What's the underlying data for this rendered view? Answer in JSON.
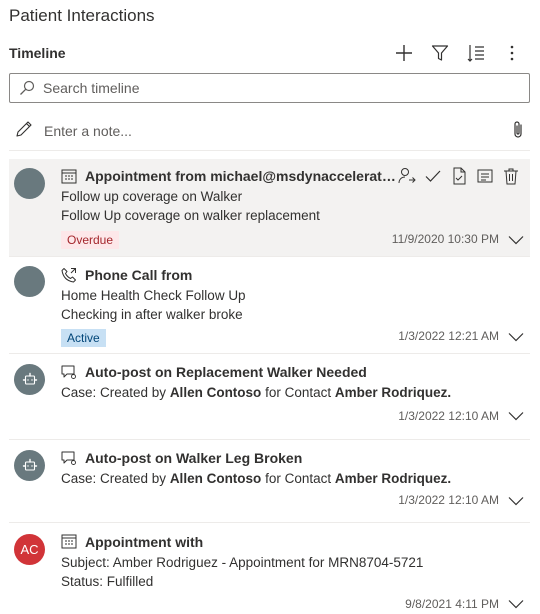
{
  "page": {
    "title": "Patient Interactions"
  },
  "timeline": {
    "label": "Timeline",
    "tools": [
      "add-icon",
      "filter-icon",
      "sort-icon",
      "more-options-icon"
    ],
    "search_placeholder": "Search timeline",
    "note_placeholder": "Enter a note..."
  },
  "items": [
    {
      "type_icon": "calendar-icon",
      "avatar": "",
      "title": "Appointment from michael@msdynaccelerators.com",
      "line1": "Follow up coverage on Walker",
      "line2": "Follow Up coverage on walker replacement",
      "badge": "Overdue",
      "date": "11/9/2020 10:30 PM"
    },
    {
      "type_icon": "phone-icon",
      "avatar": "",
      "title": "Phone Call from",
      "line1": "Home Health Check Follow Up",
      "line2": "Checking in after walker broke",
      "badge": "Active",
      "date": "1/3/2022 12:21 AM"
    },
    {
      "type_icon": "post-icon",
      "title": "Auto-post on Replacement Walker Needed",
      "line_prefix": "Case: Created by ",
      "line_person": "Allen Contoso",
      "line_mid": " for Contact ",
      "line_contact": "Amber Rodriquez.",
      "date": "1/3/2022 12:10 AM"
    },
    {
      "type_icon": "post-icon",
      "title": "Auto-post on Walker Leg Broken",
      "line_prefix": "Case: Created by ",
      "line_person": "Allen Contoso",
      "line_mid": " for Contact ",
      "line_contact": "Amber Rodriquez.",
      "date": "1/3/2022 12:10 AM"
    },
    {
      "type_icon": "calendar-icon",
      "avatar": "AC",
      "title": "Appointment with",
      "line1": "Subject: Amber Rodriguez - Appointment for MRN8704-5721",
      "line2": "Status: Fulfilled",
      "date": "9/8/2021 4:11 PM"
    }
  ],
  "colors": {
    "overdue_bg": "#fde7e9",
    "overdue_text": "#a4262c",
    "active_bg": "#c7e0f4",
    "active_text": "#004578",
    "avatar_gray": "#69797e",
    "avatar_red": "#d13438",
    "selected_bg": "#f3f2f1"
  }
}
